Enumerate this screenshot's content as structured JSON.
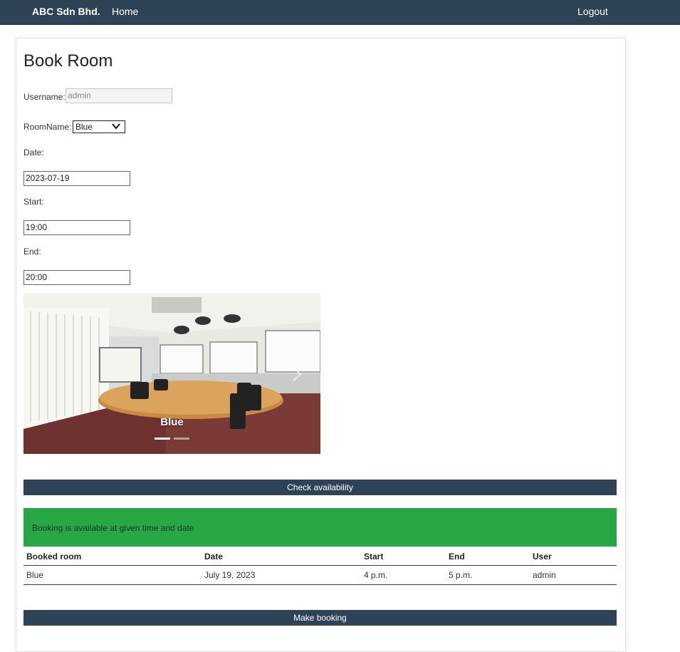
{
  "navbar": {
    "brand": "ABC Sdn Bhd.",
    "home": "Home",
    "logout": "Logout",
    "color": "#2e4356"
  },
  "page": {
    "title": "Book Room"
  },
  "form": {
    "username_label": "Username:",
    "username_value": "admin",
    "roomname_label": "RoomName:",
    "roomname_selected": "Blue",
    "date_label": "Date:",
    "date_value": "2023-07-19",
    "start_label": "Start:",
    "start_value": "19:00",
    "end_label": "End:",
    "end_value": "20:00"
  },
  "carousel": {
    "caption": "Blue",
    "active_index": 0,
    "slide_count": 2
  },
  "buttons": {
    "check": "Check availability",
    "book": "Make booking"
  },
  "alert": {
    "message": "Booking is available at given time and date",
    "color": "#28a745"
  },
  "table": {
    "headers": [
      "Booked room",
      "Date",
      "Start",
      "End",
      "User"
    ],
    "rows": [
      [
        "Blue",
        "July 19, 2023",
        "4 p.m.",
        "5 p.m.",
        "admin"
      ]
    ]
  }
}
